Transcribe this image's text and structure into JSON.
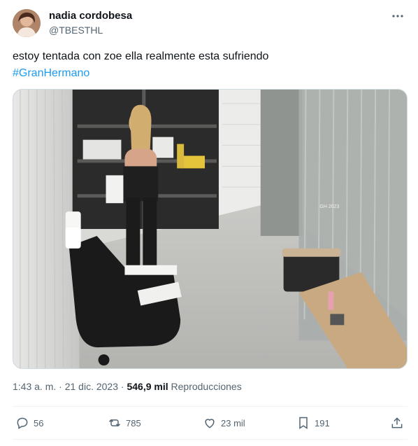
{
  "author": {
    "display_name": "nadia cordobesa",
    "handle": "@TBESTHL",
    "avatar_icon": "avatar"
  },
  "tweet": {
    "text": "estoy tentada con zoe ella realmente esta sufriendo",
    "hashtag": "#GranHermano"
  },
  "media": {
    "overlay_text": "GH\n2023"
  },
  "meta": {
    "time": "1:43 a. m.",
    "separator": "·",
    "date": "21 dic. 2023",
    "separator2": "·",
    "views_count": "546,9 mil",
    "views_label": "Reproducciones"
  },
  "actions": {
    "replies": "56",
    "retweets": "785",
    "likes": "23 mil",
    "bookmarks": "191"
  },
  "colors": {
    "accent": "#1d9bf0",
    "secondary_text": "#536471",
    "border": "#eff3f4"
  }
}
